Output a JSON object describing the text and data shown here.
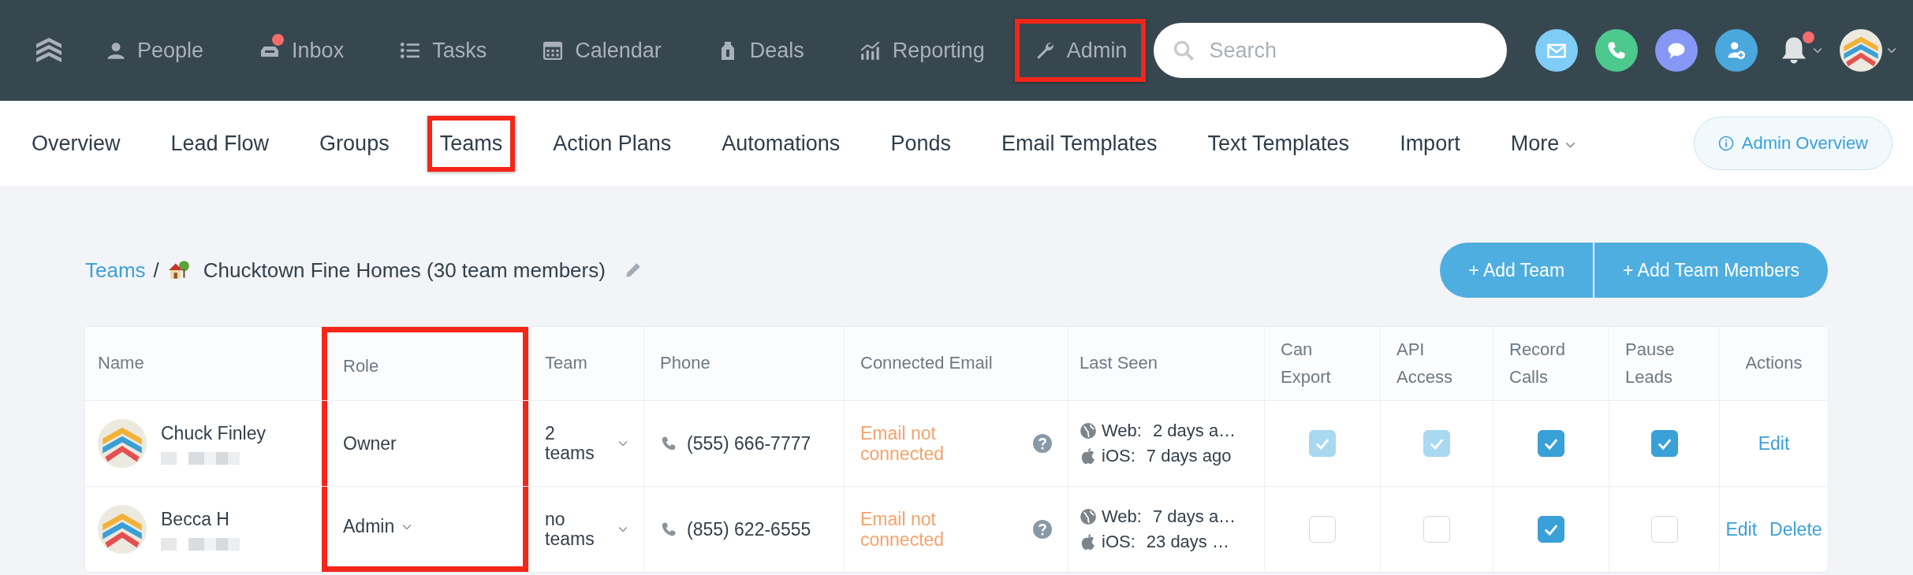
{
  "top_nav": {
    "items": [
      {
        "label": "People",
        "badge": false,
        "highlighted": false
      },
      {
        "label": "Inbox",
        "badge": true,
        "highlighted": false
      },
      {
        "label": "Tasks",
        "badge": false,
        "highlighted": false
      },
      {
        "label": "Calendar",
        "badge": false,
        "highlighted": false
      },
      {
        "label": "Deals",
        "badge": false,
        "highlighted": false
      },
      {
        "label": "Reporting",
        "badge": false,
        "highlighted": false
      },
      {
        "label": "Admin",
        "badge": false,
        "highlighted": true
      }
    ],
    "search": {
      "placeholder": "Search"
    },
    "notifications": {
      "badge": true
    }
  },
  "sub_nav": {
    "items": [
      {
        "label": "Overview",
        "dropdown": false,
        "highlighted": false
      },
      {
        "label": "Lead Flow",
        "dropdown": false,
        "highlighted": false
      },
      {
        "label": "Groups",
        "dropdown": false,
        "highlighted": false
      },
      {
        "label": "Teams",
        "dropdown": false,
        "highlighted": true
      },
      {
        "label": "Action Plans",
        "dropdown": false,
        "highlighted": false
      },
      {
        "label": "Automations",
        "dropdown": false,
        "highlighted": false
      },
      {
        "label": "Ponds",
        "dropdown": false,
        "highlighted": false
      },
      {
        "label": "Email Templates",
        "dropdown": false,
        "highlighted": false
      },
      {
        "label": "Text Templates",
        "dropdown": false,
        "highlighted": false
      },
      {
        "label": "Import",
        "dropdown": false,
        "highlighted": false
      },
      {
        "label": "More",
        "dropdown": true,
        "highlighted": false
      }
    ],
    "admin_overview": "Admin Overview"
  },
  "breadcrumb": {
    "link": "Teams",
    "separator": "/",
    "title": "Chucktown Fine Homes (30 team members)"
  },
  "buttons": [
    "+ Add Team",
    "+ Add Team Members"
  ],
  "table": {
    "columns": [
      {
        "label": "Name",
        "highlighted": false
      },
      {
        "label": "Role",
        "highlighted": true
      },
      {
        "label": "Team",
        "highlighted": false
      },
      {
        "label": "Phone",
        "highlighted": false
      },
      {
        "label": "Connected Email",
        "highlighted": false
      },
      {
        "label": "Last Seen",
        "highlighted": false
      },
      {
        "label": "Can Export",
        "highlighted": false
      },
      {
        "label": "API Access",
        "highlighted": false
      },
      {
        "label": "Record Calls",
        "highlighted": false
      },
      {
        "label": "Pause Leads",
        "highlighted": false
      },
      {
        "label": "Actions",
        "highlighted": false
      }
    ],
    "rows": [
      {
        "name": "Chuck Finley",
        "role": "Owner",
        "role_dropdown": false,
        "team": "2 teams",
        "phone": "(555) 666-7777",
        "email_status": "Email not connected",
        "web_label": "Web:",
        "web_value": "2 days a…",
        "ios_label": "iOS:",
        "ios_value": "7 days ago",
        "checks": [
          {
            "checked": true,
            "disabled": true
          },
          {
            "checked": true,
            "disabled": true
          },
          {
            "checked": true,
            "disabled": false
          },
          {
            "checked": true,
            "disabled": false
          }
        ],
        "actions": [
          "Edit"
        ]
      },
      {
        "name": "Becca H",
        "role": "Admin",
        "role_dropdown": true,
        "team": "no teams",
        "phone": "(855) 622-6555",
        "email_status": "Email not connected",
        "web_label": "Web:",
        "web_value": "7 days a…",
        "ios_label": "iOS:",
        "ios_value": "23 days …",
        "checks": [
          {
            "checked": false,
            "disabled": false
          },
          {
            "checked": false,
            "disabled": false
          },
          {
            "checked": true,
            "disabled": false
          },
          {
            "checked": false,
            "disabled": false
          }
        ],
        "actions": [
          "Edit",
          "Delete"
        ]
      }
    ]
  }
}
